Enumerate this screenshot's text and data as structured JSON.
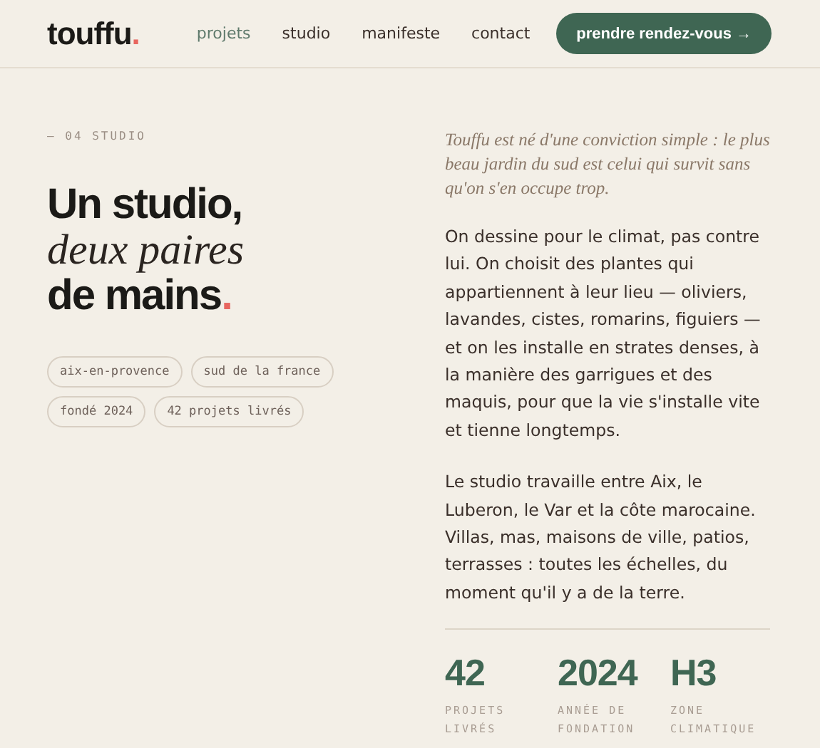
{
  "header": {
    "logo": "touffu",
    "logo_dot": ".",
    "nav": [
      {
        "label": "projets",
        "selected": true
      },
      {
        "label": "studio",
        "selected": false
      },
      {
        "label": "manifeste",
        "selected": false
      },
      {
        "label": "contact",
        "selected": false
      }
    ],
    "cta": "prendre rendez-vous →"
  },
  "intro": {
    "eyebrow": "— 04 STUDIO",
    "headline": [
      "Un studio,",
      "deux paires",
      "de mains"
    ],
    "headline_dot": ".",
    "tags": [
      "aix-en-provence",
      "sud de la france",
      "fondé 2024",
      "42 projets livrés"
    ]
  },
  "text": {
    "lead": "Touffu est né d'une conviction simple : le plus beau jardin du sud est celui qui survit sans qu'on s'en occupe trop.",
    "paragraphs": [
      "On dessine pour le climat, pas contre lui. On choisit des plantes qui appartiennent à leur lieu — oliviers, lavandes, cistes, romarins, figuiers — et on les installe en strates denses, à la manière des garrigues et des maquis, pour que la vie s'installe vite et tienne longtemps.",
      "Le studio travaille entre Aix, le Luberon, le Var et la côte marocaine. Villas, mas, maisons de ville, patios, terrasses : toutes les échelles, du moment qu'il y a de la terre."
    ]
  },
  "stats": [
    {
      "value": "42",
      "label": "PROJETS LIVRÉS"
    },
    {
      "value": "2024",
      "label": "ANNÉE DE FONDATION"
    },
    {
      "value": "H3",
      "label": "ZONE CLIMATIQUE"
    }
  ]
}
